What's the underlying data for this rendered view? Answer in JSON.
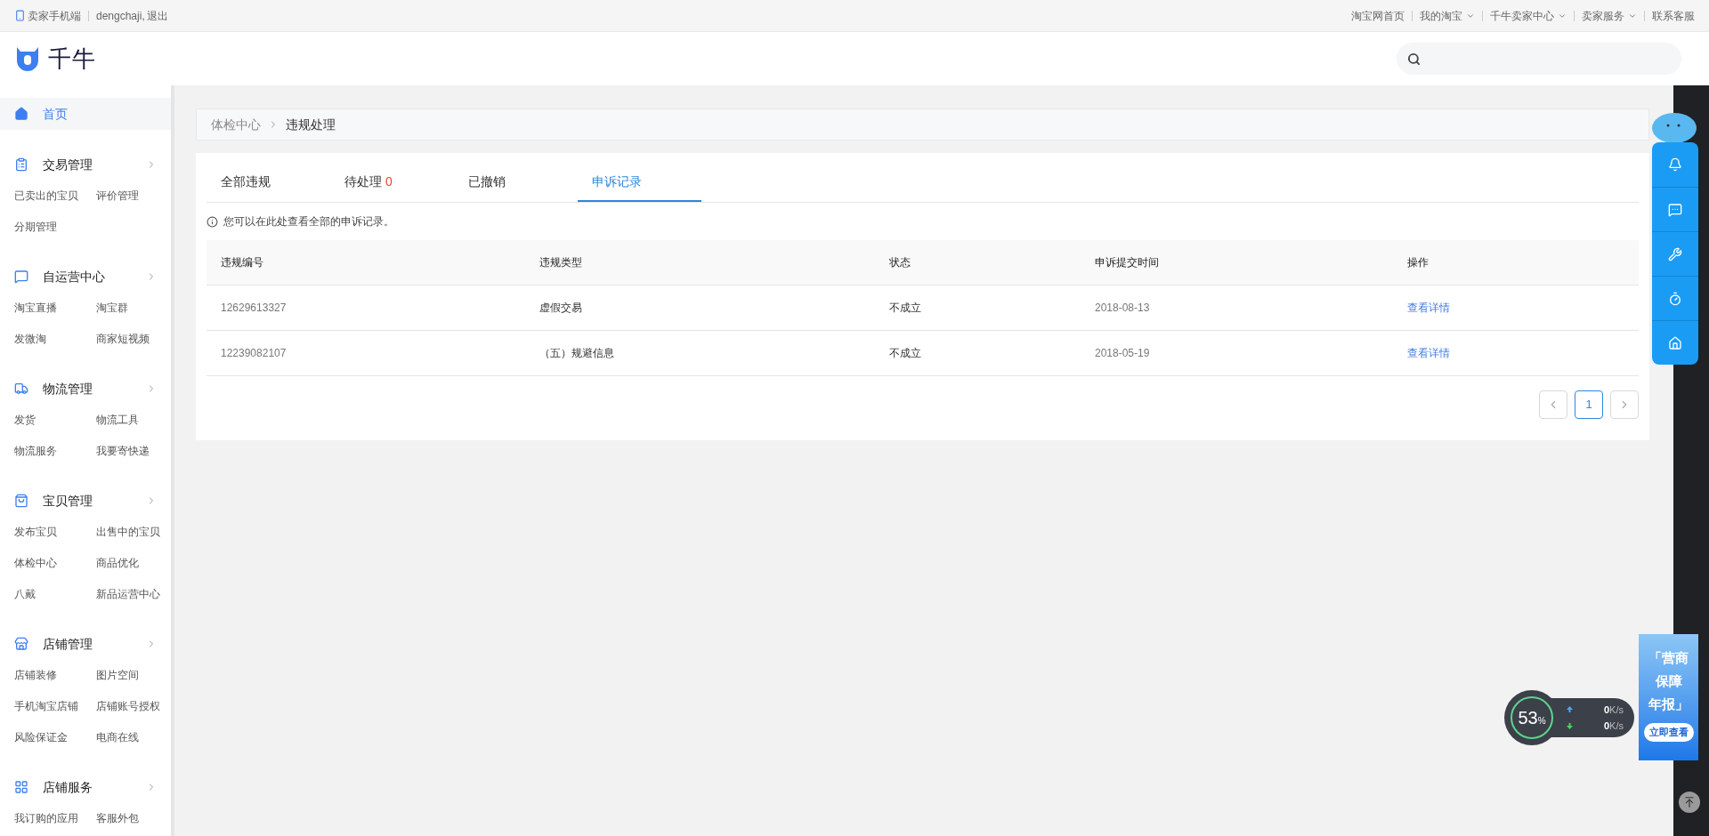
{
  "top_bar": {
    "mobile_link": "卖家手机端",
    "user": "dengchaji,",
    "logout": "退出",
    "links": [
      {
        "label": "淘宝网首页",
        "dropdown": false
      },
      {
        "label": "我的淘宝",
        "dropdown": true
      },
      {
        "label": "千牛卖家中心",
        "dropdown": true
      },
      {
        "label": "卖家服务",
        "dropdown": true
      },
      {
        "label": "联系客服",
        "dropdown": false
      }
    ]
  },
  "header": {
    "logo_text": "千牛"
  },
  "sidebar": {
    "home": {
      "label": "首页",
      "selected": true
    },
    "sections": [
      {
        "title": "交易管理",
        "items": [
          "已卖出的宝贝",
          "评价管理",
          "分期管理"
        ]
      },
      {
        "title": "自运营中心",
        "items": [
          "淘宝直播",
          "淘宝群",
          "发微淘",
          "商家短视频"
        ]
      },
      {
        "title": "物流管理",
        "items": [
          "发货",
          "物流工具",
          "物流服务",
          "我要寄快递"
        ]
      },
      {
        "title": "宝贝管理",
        "items": [
          "发布宝贝",
          "出售中的宝贝",
          "体检中心",
          "商品优化",
          "八戴",
          "新品运营中心"
        ]
      },
      {
        "title": "店铺管理",
        "items": [
          "店铺装修",
          "图片空间",
          "手机淘宝店铺",
          "店铺账号授权",
          "风险保证金",
          "电商在线"
        ]
      },
      {
        "title": "店铺服务",
        "items": [
          "我订购的应用",
          "客服外包"
        ]
      }
    ]
  },
  "breadcrumb": [
    "体检中心",
    "违规处理"
  ],
  "tabs": [
    {
      "label": "全部违规",
      "selected": false
    },
    {
      "label": "待处理",
      "count": "0",
      "selected": false
    },
    {
      "label": "已撤销",
      "selected": false
    },
    {
      "label": "申诉记录",
      "selected": true
    }
  ],
  "notice": "您可以在此处查看全部的申诉记录。",
  "table": {
    "columns": [
      "违规编号",
      "违规类型",
      "状态",
      "申诉提交时间",
      "操作"
    ],
    "rows": [
      {
        "id": "12629613327",
        "type": "虚假交易",
        "status": "不成立",
        "date": "2018-08-13",
        "action": "查看详情"
      },
      {
        "id": "12239082107",
        "type": "（五）规避信息",
        "status": "不成立",
        "date": "2018-05-19",
        "action": "查看详情"
      }
    ]
  },
  "pagination": {
    "pages": [
      {
        "label": "1",
        "selected": true
      }
    ]
  },
  "speed_meter": {
    "value": "53",
    "unit": "%",
    "up": "0",
    "up_unit": "K/s",
    "down": "0",
    "down_unit": "K/s"
  },
  "promo": {
    "lines": [
      "「营商",
      "保障",
      "年报」"
    ],
    "button": "立即查看"
  }
}
